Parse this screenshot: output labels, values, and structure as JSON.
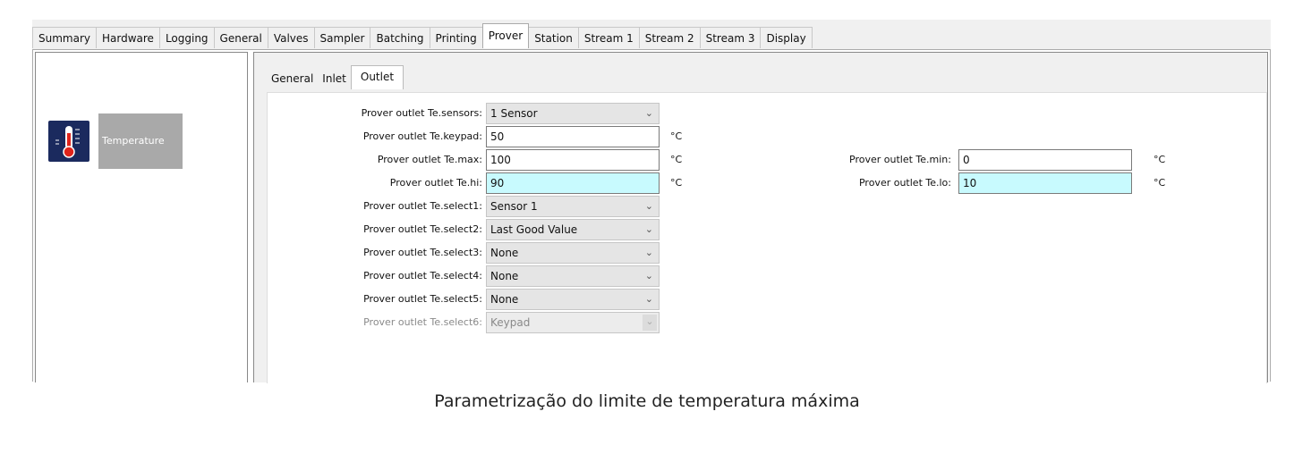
{
  "main_tabs": [
    "Summary",
    "Hardware",
    "Logging",
    "General",
    "Valves",
    "Sampler",
    "Batching",
    "Printing",
    "Prover",
    "Station",
    "Stream 1",
    "Stream 2",
    "Stream 3",
    "Display"
  ],
  "active_main_tab": "Prover",
  "sidebar": {
    "button_label": "Temperature",
    "icon": "thermometer-icon"
  },
  "sub_tabs": [
    "General",
    "Inlet",
    "Outlet"
  ],
  "active_sub_tab": "Outlet",
  "form": {
    "sensors": {
      "label": "Prover outlet Te.sensors:",
      "value": "1 Sensor"
    },
    "keypad": {
      "label": "Prover outlet Te.keypad:",
      "value": "50",
      "unit": "°C"
    },
    "max": {
      "label": "Prover outlet Te.max:",
      "value": "100",
      "unit": "°C"
    },
    "hi": {
      "label": "Prover outlet Te.hi:",
      "value": "90",
      "unit": "°C"
    },
    "min": {
      "label": "Prover outlet Te.min:",
      "value": "0",
      "unit": "°C"
    },
    "lo": {
      "label": "Prover outlet Te.lo:",
      "value": "10",
      "unit": "°C"
    },
    "select1": {
      "label": "Prover outlet Te.select1:",
      "value": "Sensor 1"
    },
    "select2": {
      "label": "Prover outlet Te.select2:",
      "value": "Last Good Value"
    },
    "select3": {
      "label": "Prover outlet Te.select3:",
      "value": "None"
    },
    "select4": {
      "label": "Prover outlet Te.select4:",
      "value": "None"
    },
    "select5": {
      "label": "Prover outlet Te.select5:",
      "value": "None"
    },
    "select6": {
      "label": "Prover outlet Te.select6:",
      "value": "Keypad"
    }
  },
  "colors": {
    "highlight_field": "#c8fafe",
    "sidebar_button": "#a9a9a9",
    "icon_bg": "#1b2a5e"
  },
  "caption": "Parametrização do limite de temperatura máxima"
}
